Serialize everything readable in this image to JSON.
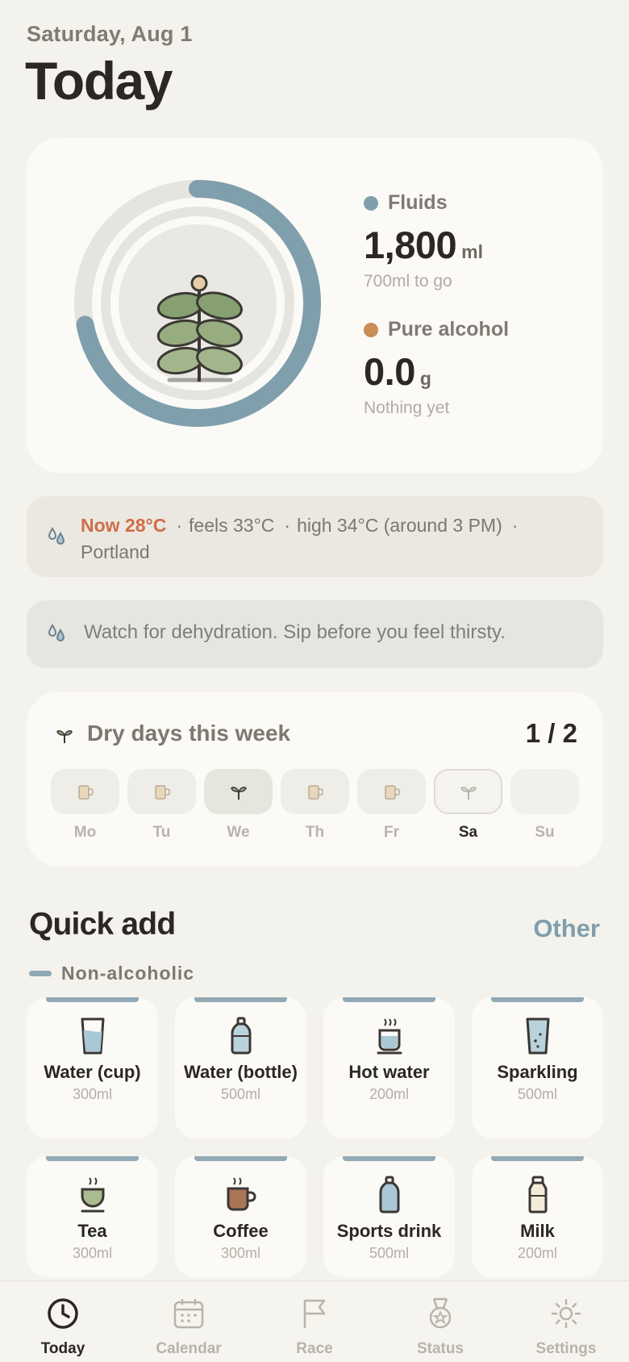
{
  "header": {
    "date": "Saturday, Aug 1",
    "title": "Today"
  },
  "summary": {
    "fluid_progress": 0.72,
    "fluids": {
      "label": "Fluids",
      "value": "1,800",
      "unit": "ml",
      "note": "700ml to go",
      "color": "#809fad"
    },
    "alcohol": {
      "label": "Pure alcohol",
      "value": "0.0",
      "unit": "g",
      "note": "Nothing yet",
      "color": "#c98d57"
    }
  },
  "weather": {
    "now": "Now 28°C",
    "feels": "feels 33°C",
    "high": "high 34°C (around 3 PM)",
    "city": "Portland",
    "icon": "water-drops-icon"
  },
  "tip": {
    "text": "Watch for dehydration. Sip before you feel thirsty."
  },
  "dry_days": {
    "title": "Dry days this week",
    "count": "1 / 2",
    "days": [
      {
        "label": "Mo",
        "state": "drink"
      },
      {
        "label": "Tu",
        "state": "drink"
      },
      {
        "label": "We",
        "state": "dry"
      },
      {
        "label": "Th",
        "state": "drink"
      },
      {
        "label": "Fr",
        "state": "drink"
      },
      {
        "label": "Sa",
        "state": "today"
      },
      {
        "label": "Su",
        "state": "empty"
      }
    ]
  },
  "quick_add": {
    "title": "Quick add",
    "other": "Other",
    "section": "Non-alcoholic",
    "items": [
      {
        "name": "Water (cup)",
        "volume": "300ml",
        "icon": "water-cup-icon"
      },
      {
        "name": "Water (bottle)",
        "volume": "500ml",
        "icon": "water-bottle-icon"
      },
      {
        "name": "Hot water",
        "volume": "200ml",
        "icon": "hot-water-icon"
      },
      {
        "name": "Sparkling",
        "volume": "500ml",
        "icon": "sparkling-icon"
      },
      {
        "name": "Tea",
        "volume": "300ml",
        "icon": "tea-icon"
      },
      {
        "name": "Coffee",
        "volume": "300ml",
        "icon": "coffee-icon"
      },
      {
        "name": "Sports drink",
        "volume": "500ml",
        "icon": "sports-drink-icon"
      },
      {
        "name": "Milk",
        "volume": "200ml",
        "icon": "milk-icon"
      }
    ]
  },
  "tabs": [
    {
      "label": "Today",
      "icon": "clock-icon",
      "active": true
    },
    {
      "label": "Calendar",
      "icon": "calendar-icon",
      "active": false
    },
    {
      "label": "Race",
      "icon": "flag-icon",
      "active": false
    },
    {
      "label": "Status",
      "icon": "medal-icon",
      "active": false
    },
    {
      "label": "Settings",
      "icon": "gear-icon",
      "active": false
    }
  ]
}
